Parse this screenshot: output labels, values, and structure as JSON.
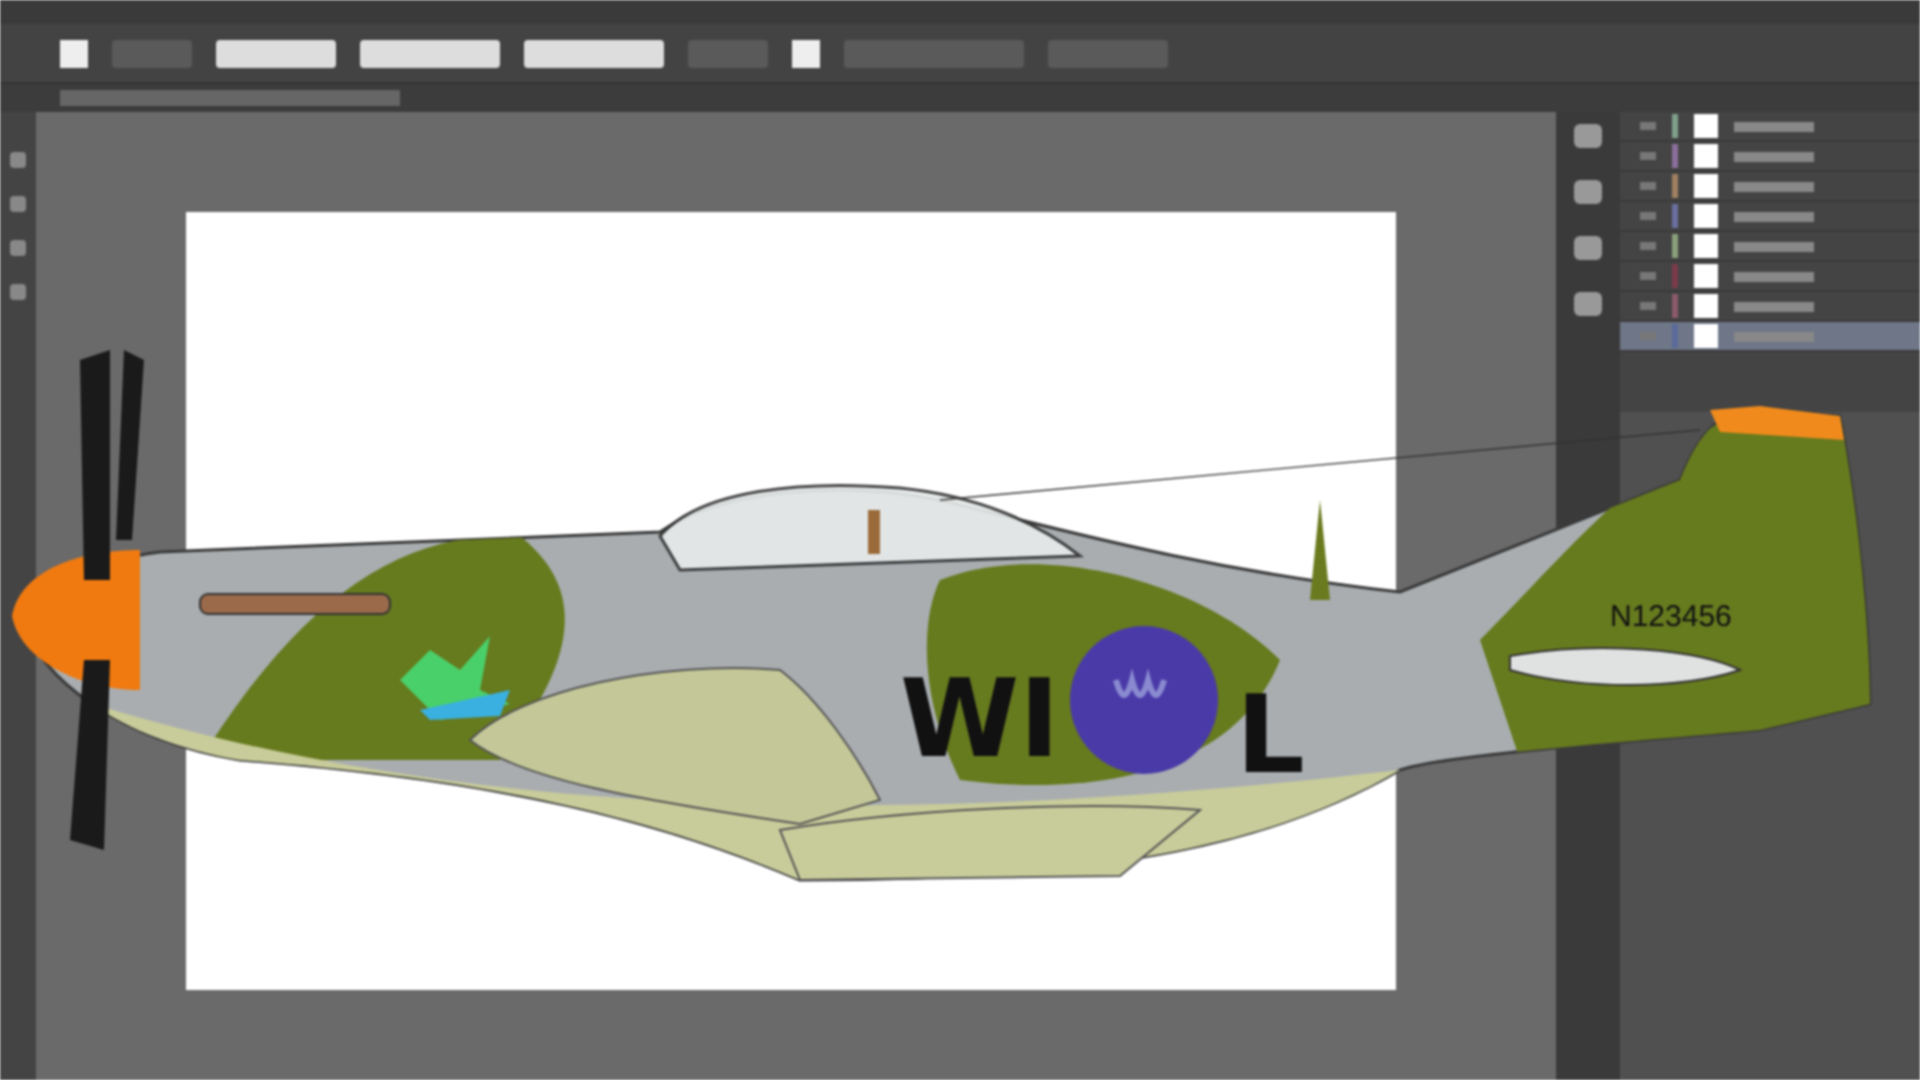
{
  "layers": [
    {
      "color": "#7fa08a",
      "selected": false
    },
    {
      "color": "#8a6f9a",
      "selected": false
    },
    {
      "color": "#a08060",
      "selected": false
    },
    {
      "color": "#6a6fa0",
      "selected": false
    },
    {
      "color": "#8aa07a",
      "selected": false
    },
    {
      "color": "#7a3a4a",
      "selected": false
    },
    {
      "color": "#8a5a6a",
      "selected": false
    },
    {
      "color": "#5a6a9a",
      "selected": true
    }
  ],
  "plane": {
    "code": "WI",
    "letter": "L",
    "serial": "N123456"
  }
}
